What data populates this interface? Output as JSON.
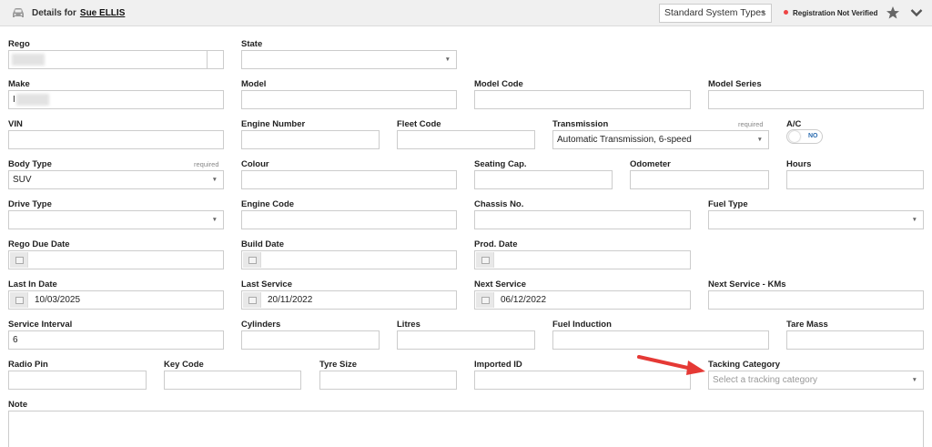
{
  "header": {
    "details_for": "Details for",
    "customer_name": "Sue ELLIS",
    "system_types": "Standard System Types",
    "registration_status": "Registration Not Verified"
  },
  "fields": {
    "rego": {
      "label": "Rego",
      "value": ""
    },
    "state": {
      "label": "State",
      "value": ""
    },
    "make": {
      "label": "Make",
      "value": "I"
    },
    "model": {
      "label": "Model",
      "value": ""
    },
    "model_code": {
      "label": "Model Code",
      "value": ""
    },
    "model_series": {
      "label": "Model Series",
      "value": ""
    },
    "vin": {
      "label": "VIN",
      "value": ""
    },
    "engine_number": {
      "label": "Engine Number",
      "value": ""
    },
    "fleet_code": {
      "label": "Fleet Code",
      "value": ""
    },
    "transmission": {
      "label": "Transmission",
      "required": "required",
      "value": "Automatic Transmission, 6-speed"
    },
    "ac": {
      "label": "A/C",
      "value": "NO"
    },
    "body_type": {
      "label": "Body Type",
      "required": "required",
      "value": "SUV"
    },
    "colour": {
      "label": "Colour",
      "value": ""
    },
    "seating_cap": {
      "label": "Seating Cap.",
      "value": ""
    },
    "odometer": {
      "label": "Odometer",
      "value": ""
    },
    "hours": {
      "label": "Hours",
      "value": ""
    },
    "drive_type": {
      "label": "Drive Type",
      "value": ""
    },
    "engine_code": {
      "label": "Engine Code",
      "value": ""
    },
    "chassis_no": {
      "label": "Chassis No.",
      "value": ""
    },
    "fuel_type": {
      "label": "Fuel Type",
      "value": ""
    },
    "rego_due_date": {
      "label": "Rego Due Date",
      "value": ""
    },
    "build_date": {
      "label": "Build Date",
      "value": ""
    },
    "prod_date": {
      "label": "Prod. Date",
      "value": ""
    },
    "last_in_date": {
      "label": "Last In Date",
      "value": "10/03/2025"
    },
    "last_service": {
      "label": "Last Service",
      "value": "20/11/2022"
    },
    "next_service": {
      "label": "Next Service",
      "value": "06/12/2022"
    },
    "next_service_kms": {
      "label": "Next Service - KMs",
      "value": ""
    },
    "service_interval": {
      "label": "Service Interval",
      "value": "6"
    },
    "cylinders": {
      "label": "Cylinders",
      "value": ""
    },
    "litres": {
      "label": "Litres",
      "value": ""
    },
    "fuel_induction": {
      "label": "Fuel Induction",
      "value": ""
    },
    "tare_mass": {
      "label": "Tare Mass",
      "value": ""
    },
    "radio_pin": {
      "label": "Radio Pin",
      "value": ""
    },
    "key_code": {
      "label": "Key Code",
      "value": ""
    },
    "tyre_size": {
      "label": "Tyre Size",
      "value": ""
    },
    "imported_id": {
      "label": "Imported ID",
      "value": ""
    },
    "tracking_category": {
      "label": "Tacking Category",
      "placeholder": "Select a tracking category"
    },
    "note": {
      "label": "Note",
      "value": ""
    }
  },
  "colors": {
    "annotation_arrow": "#e53935",
    "status_dot": "#e44444"
  }
}
